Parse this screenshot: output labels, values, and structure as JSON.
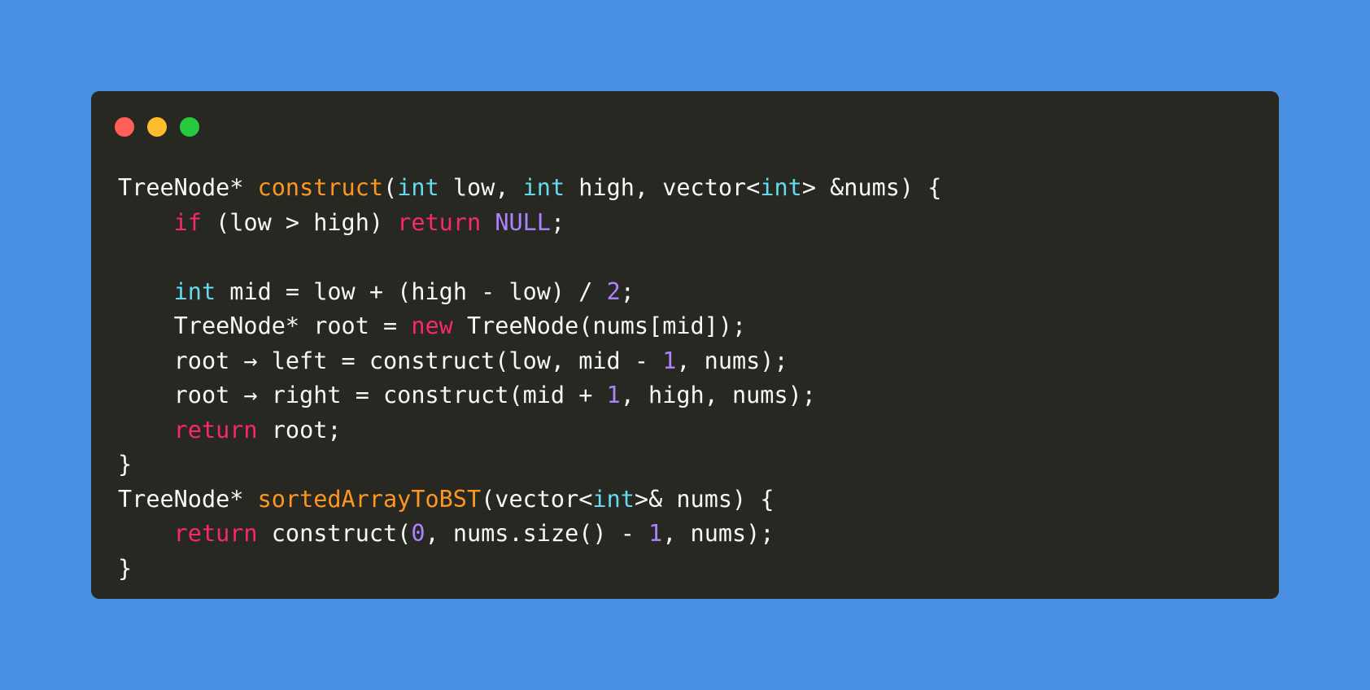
{
  "window": {
    "controls": [
      "close",
      "minimize",
      "maximize"
    ]
  },
  "colors": {
    "background": "#4a90e2",
    "editor": "#282823",
    "plain": "#f8f8f2",
    "type": "#66d9ef",
    "function": "#fd971f",
    "keyword": "#f92672",
    "number": "#ae81ff"
  },
  "code": {
    "lines": [
      [
        {
          "t": "TreeNode* ",
          "k": "plain"
        },
        {
          "t": "construct",
          "k": "fn"
        },
        {
          "t": "(",
          "k": "plain"
        },
        {
          "t": "int",
          "k": "type"
        },
        {
          "t": " low, ",
          "k": "plain"
        },
        {
          "t": "int",
          "k": "type"
        },
        {
          "t": " high, vector<",
          "k": "plain"
        },
        {
          "t": "int",
          "k": "type"
        },
        {
          "t": "> &nums) {",
          "k": "plain"
        }
      ],
      [
        {
          "t": "    ",
          "k": "plain"
        },
        {
          "t": "if",
          "k": "kw"
        },
        {
          "t": " (low > high) ",
          "k": "plain"
        },
        {
          "t": "return",
          "k": "kw"
        },
        {
          "t": " ",
          "k": "plain"
        },
        {
          "t": "NULL",
          "k": "const"
        },
        {
          "t": ";",
          "k": "plain"
        }
      ],
      [],
      [
        {
          "t": "    ",
          "k": "plain"
        },
        {
          "t": "int",
          "k": "type"
        },
        {
          "t": " mid = low + (high - low) / ",
          "k": "plain"
        },
        {
          "t": "2",
          "k": "num"
        },
        {
          "t": ";",
          "k": "plain"
        }
      ],
      [
        {
          "t": "    TreeNode* root = ",
          "k": "plain"
        },
        {
          "t": "new",
          "k": "kw"
        },
        {
          "t": " TreeNode(nums[mid]);",
          "k": "plain"
        }
      ],
      [
        {
          "t": "    root → left = construct(low, mid - ",
          "k": "plain"
        },
        {
          "t": "1",
          "k": "num"
        },
        {
          "t": ", nums);",
          "k": "plain"
        }
      ],
      [
        {
          "t": "    root → right = construct(mid + ",
          "k": "plain"
        },
        {
          "t": "1",
          "k": "num"
        },
        {
          "t": ", high, nums);",
          "k": "plain"
        }
      ],
      [
        {
          "t": "    ",
          "k": "plain"
        },
        {
          "t": "return",
          "k": "kw"
        },
        {
          "t": " root;",
          "k": "plain"
        }
      ],
      [
        {
          "t": "}",
          "k": "plain"
        }
      ],
      [
        {
          "t": "TreeNode* ",
          "k": "plain"
        },
        {
          "t": "sortedArrayToBST",
          "k": "fn"
        },
        {
          "t": "(vector<",
          "k": "plain"
        },
        {
          "t": "int",
          "k": "type"
        },
        {
          "t": ">& nums) {",
          "k": "plain"
        }
      ],
      [
        {
          "t": "    ",
          "k": "plain"
        },
        {
          "t": "return",
          "k": "kw"
        },
        {
          "t": " construct(",
          "k": "plain"
        },
        {
          "t": "0",
          "k": "num"
        },
        {
          "t": ", nums.size() - ",
          "k": "plain"
        },
        {
          "t": "1",
          "k": "num"
        },
        {
          "t": ", nums);",
          "k": "plain"
        }
      ],
      [
        {
          "t": "}",
          "k": "plain"
        }
      ]
    ]
  }
}
